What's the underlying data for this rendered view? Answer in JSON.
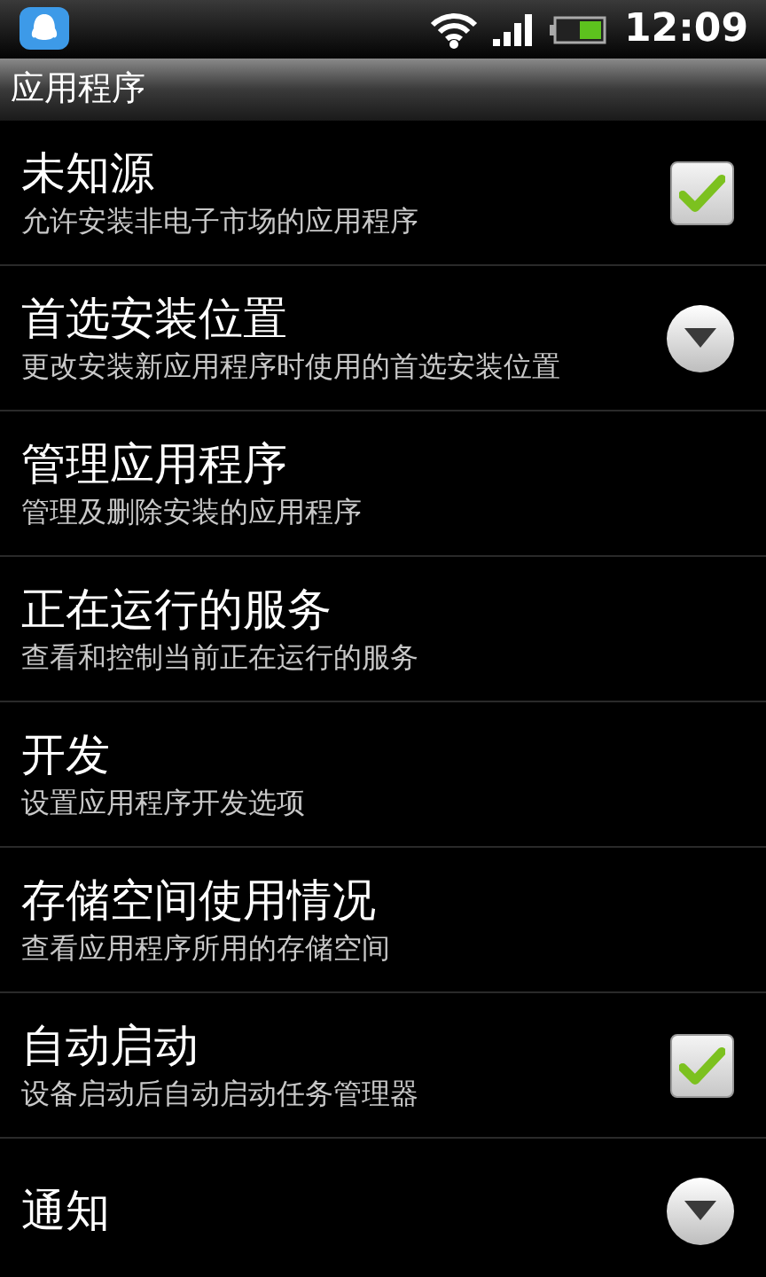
{
  "status_bar": {
    "time": "12:09"
  },
  "header": {
    "title": "应用程序"
  },
  "items": [
    {
      "kind": "checkbox",
      "title": "未知源",
      "subtitle": "允许安装非电子市场的应用程序",
      "checked": true
    },
    {
      "kind": "dropdown",
      "title": "首选安装位置",
      "subtitle": "更改安装新应用程序时使用的首选安装位置"
    },
    {
      "kind": "plain",
      "title": "管理应用程序",
      "subtitle": "管理及删除安装的应用程序"
    },
    {
      "kind": "plain",
      "title": "正在运行的服务",
      "subtitle": "查看和控制当前正在运行的服务"
    },
    {
      "kind": "plain",
      "title": "开发",
      "subtitle": "设置应用程序开发选项"
    },
    {
      "kind": "plain",
      "title": "存储空间使用情况",
      "subtitle": "查看应用程序所用的存储空间"
    },
    {
      "kind": "checkbox",
      "title": "自动启动",
      "subtitle": "设备启动后自动启动任务管理器",
      "checked": true
    },
    {
      "kind": "dropdown",
      "title": "通知"
    }
  ]
}
